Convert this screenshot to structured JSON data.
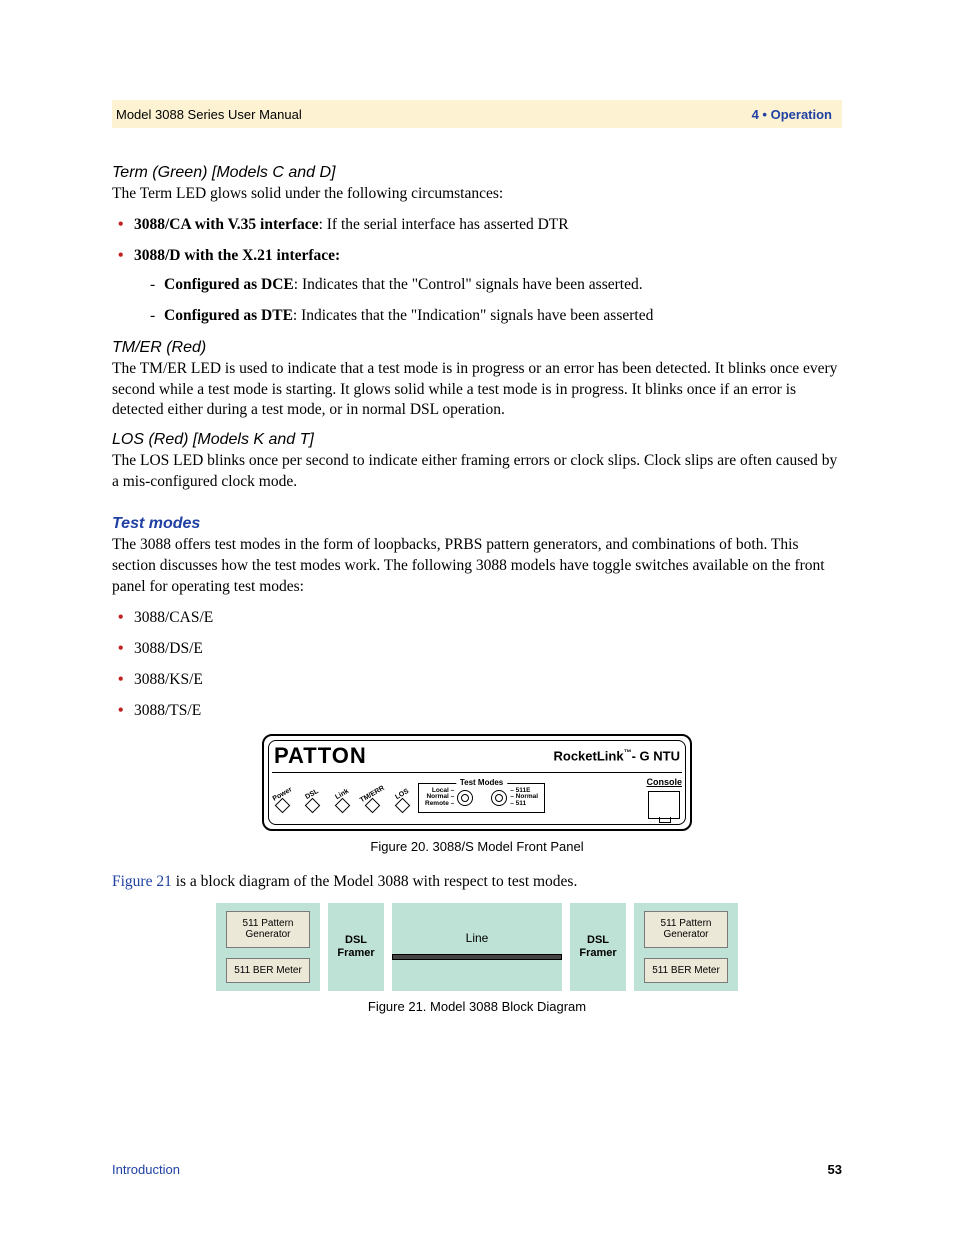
{
  "header": {
    "left": "Model 3088 Series User Manual",
    "right": "4 • Operation"
  },
  "sec_term": {
    "heading": "Term (Green) [Models C and D]",
    "intro": "The Term LED glows solid under the following circumstances:",
    "bullet1_bold": "3088/CA with V.35 interface",
    "bullet1_rest": ": If the serial interface has asserted DTR",
    "bullet2_bold": "3088/D with the X.21 interface:",
    "sub1_bold": "Configured as DCE",
    "sub1_rest": ": Indicates that the \"Control\" signals have been asserted.",
    "sub2_bold": "Configured as DTE",
    "sub2_rest": ": Indicates that the \"Indication\" signals have been asserted"
  },
  "sec_tmer": {
    "heading": "TM/ER (Red)",
    "body": "The TM/ER LED is used to indicate that a test mode is in progress or an error has been detected. It blinks once every second while a test mode is starting. It glows solid while a test mode is in progress. It blinks once if an error is detected either during a test mode, or in normal DSL operation."
  },
  "sec_los": {
    "heading": "LOS (Red) [Models K and T]",
    "body": "The LOS LED blinks once per second to indicate either framing errors or clock slips. Clock slips are often caused by a mis-configured clock mode."
  },
  "sec_test": {
    "heading": "Test modes",
    "intro": "The 3088 offers test modes in the form of loopbacks, PRBS pattern generators, and combinations of both. This section discusses how the test modes work. The following 3088 models have toggle switches available on the front panel for operating test modes:",
    "items": [
      "3088/CAS/E",
      "3088/DS/E",
      "3088/KS/E",
      "3088/TS/E"
    ]
  },
  "fig20": {
    "brand": "PATTON",
    "product": "RocketLink™- G NTU",
    "leds": [
      "Power",
      "DSL",
      "Link",
      "TM/ERR",
      "LOS"
    ],
    "tm_title": "Test Modes",
    "sw_left": [
      "Local –",
      "Normal –",
      "Remote –"
    ],
    "sw_right": [
      "– 511E",
      "– Normal",
      "– 511"
    ],
    "console": "Console",
    "caption": "Figure 20. 3088/S Model Front Panel"
  },
  "fig21": {
    "lead_link": "Figure 21",
    "lead_rest": " is a block diagram of the Model 3088 with respect to test modes.",
    "pattern": "511 Pattern Generator",
    "ber": "511 BER Meter",
    "dsl": "DSL Framer",
    "line": "Line",
    "caption": "Figure 21. Model 3088 Block Diagram"
  },
  "footer": {
    "left": "Introduction",
    "right": "53"
  }
}
